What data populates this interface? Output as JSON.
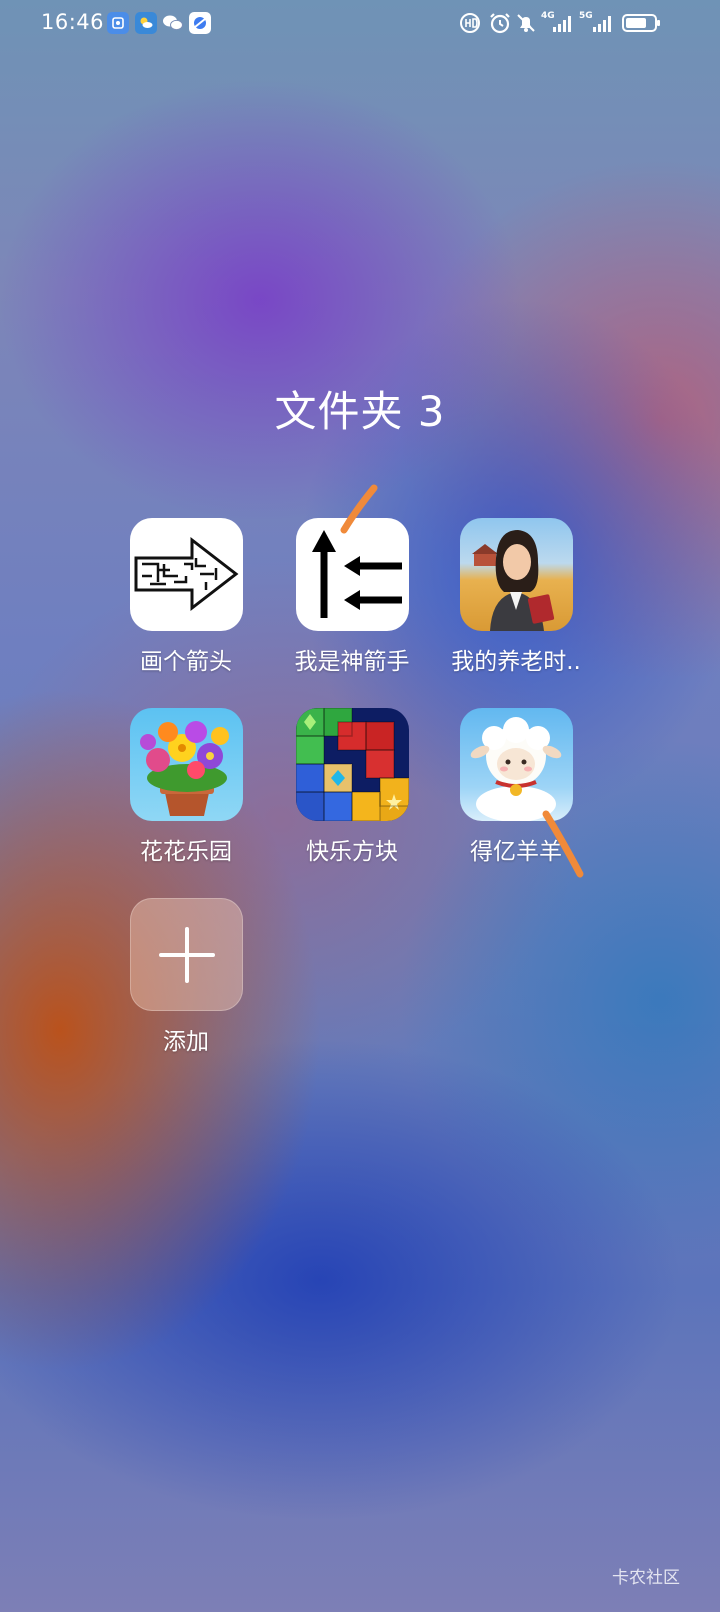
{
  "status_bar": {
    "time": "16:46",
    "notification_icons": [
      "gallery-app-icon",
      "weather-icon",
      "wechat-icon",
      "browser-icon"
    ],
    "system_icons": [
      "hd-icon",
      "alarm-icon",
      "mute-icon",
      "signal-4g-icon",
      "signal-5g-icon",
      "battery-icon"
    ],
    "network_4g": "4G",
    "network_5g": "5G"
  },
  "folder": {
    "title": "文件夹 3",
    "apps": [
      {
        "label": "画个箭头",
        "icon": "maze-arrow-icon"
      },
      {
        "label": "我是神箭手",
        "icon": "arrows-icon"
      },
      {
        "label": "我的养老时..",
        "icon": "retirement-woman-icon"
      },
      {
        "label": "花花乐园",
        "icon": "flower-pot-icon"
      },
      {
        "label": "快乐方块",
        "icon": "block-puzzle-icon"
      },
      {
        "label": "得亿羊羊",
        "icon": "sheep-icon"
      }
    ],
    "add_label": "添加"
  },
  "watermark": "卡农社区",
  "colors": {
    "annotation_stroke": "#f08a3a"
  }
}
